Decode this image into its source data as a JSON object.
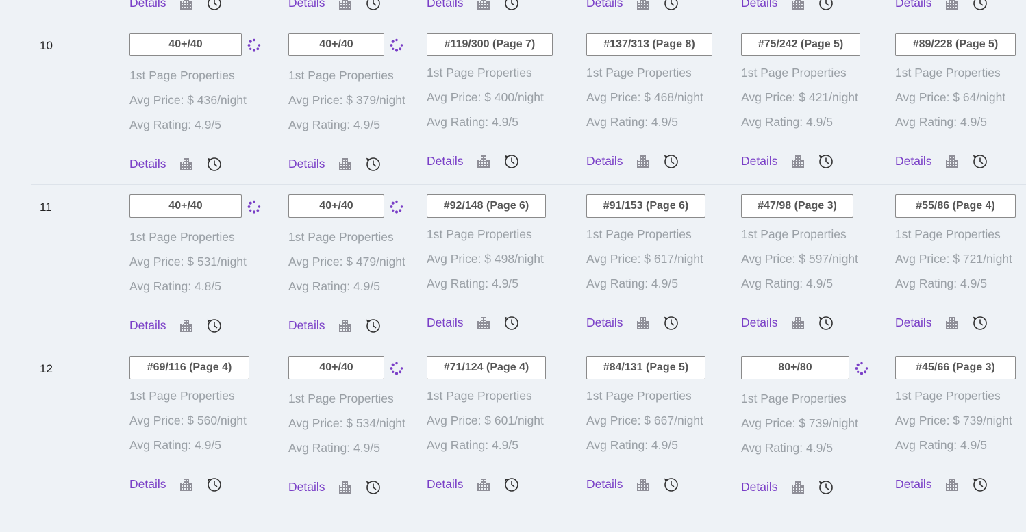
{
  "labels": {
    "first_page": "1st Page Properties",
    "details": "Details"
  },
  "colors": {
    "accent": "#7a3fc7",
    "muted": "#9aa0a6",
    "bg": "#eef2f6"
  },
  "icons": {
    "building": "building-icon",
    "history": "history-icon",
    "loading": "loading-spinner-icon"
  },
  "top_partial_row": {
    "details": [
      "Details",
      "Details",
      "Details",
      "Details",
      "Details",
      "Details"
    ]
  },
  "rows": [
    {
      "num": "10",
      "cells": [
        {
          "rank": "40+/40",
          "loading": true,
          "price": "Avg Price: $ 436/night",
          "rating": "Avg Rating: 4.9/5"
        },
        {
          "rank": "40+/40",
          "loading": true,
          "price": "Avg Price: $ 379/night",
          "rating": "Avg Rating: 4.9/5"
        },
        {
          "rank": "#119/300 (Page 7)",
          "loading": false,
          "price": "Avg Price: $ 400/night",
          "rating": "Avg Rating: 4.9/5"
        },
        {
          "rank": "#137/313 (Page 8)",
          "loading": false,
          "price": "Avg Price: $ 468/night",
          "rating": "Avg Rating: 4.9/5"
        },
        {
          "rank": "#75/242 (Page 5)",
          "loading": false,
          "price": "Avg Price: $ 421/night",
          "rating": "Avg Rating: 4.9/5"
        },
        {
          "rank": "#89/228 (Page 5)",
          "loading": false,
          "price": "Avg Price: $ 64/night",
          "rating": "Avg Rating: 4.9/5"
        }
      ]
    },
    {
      "num": "11",
      "cells": [
        {
          "rank": "40+/40",
          "loading": true,
          "price": "Avg Price: $ 531/night",
          "rating": "Avg Rating: 4.8/5"
        },
        {
          "rank": "40+/40",
          "loading": true,
          "price": "Avg Price: $ 479/night",
          "rating": "Avg Rating: 4.9/5"
        },
        {
          "rank": "#92/148 (Page 6)",
          "loading": false,
          "price": "Avg Price: $ 498/night",
          "rating": "Avg Rating: 4.9/5"
        },
        {
          "rank": "#91/153 (Page 6)",
          "loading": false,
          "price": "Avg Price: $ 617/night",
          "rating": "Avg Rating: 4.9/5"
        },
        {
          "rank": "#47/98 (Page 3)",
          "loading": false,
          "price": "Avg Price: $ 597/night",
          "rating": "Avg Rating: 4.9/5"
        },
        {
          "rank": "#55/86 (Page 4)",
          "loading": false,
          "price": "Avg Price: $ 721/night",
          "rating": "Avg Rating: 4.9/5"
        }
      ]
    },
    {
      "num": "12",
      "cells": [
        {
          "rank": "#69/116 (Page 4)",
          "loading": false,
          "price": "Avg Price: $ 560/night",
          "rating": "Avg Rating: 4.9/5"
        },
        {
          "rank": "40+/40",
          "loading": true,
          "price": "Avg Price: $ 534/night",
          "rating": "Avg Rating: 4.9/5"
        },
        {
          "rank": "#71/124 (Page 4)",
          "loading": false,
          "price": "Avg Price: $ 601/night",
          "rating": "Avg Rating: 4.9/5"
        },
        {
          "rank": "#84/131 (Page 5)",
          "loading": false,
          "price": "Avg Price: $ 667/night",
          "rating": "Avg Rating: 4.9/5"
        },
        {
          "rank": "80+/80",
          "loading": true,
          "price": "Avg Price: $ 739/night",
          "rating": "Avg Rating: 4.9/5"
        },
        {
          "rank": "#45/66 (Page 3)",
          "loading": false,
          "price": "Avg Price: $ 739/night",
          "rating": "Avg Rating: 4.9/5"
        }
      ]
    }
  ]
}
